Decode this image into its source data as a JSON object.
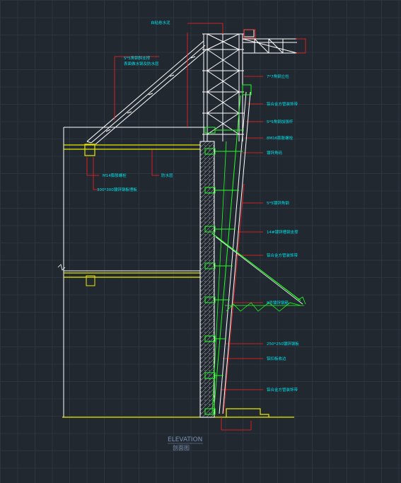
{
  "title": "ELEVATION",
  "subtitle": "剖面图",
  "labels": {
    "top_water": "自粘卷水泥",
    "steel_angle_a": "5*5角钢斜支撑",
    "steel_angle_b": "表面做水钢及防水层",
    "steel_77": "7*7角钢立柱",
    "aluminum_panel_1": "铝合金方管装饰带",
    "steel_55": "5*5角钢加强杆",
    "bolt": "8M16膨胀螺栓",
    "connect_angle": "镀锌角码",
    "bolt_m14": "M14膨胀螺栓",
    "membrane": "防水层",
    "embed_plate": "300*300镀锌钢板埋板",
    "galv_angle": "5*5镀锌角钢",
    "galv_support": "14#镀锌槽钢支撑",
    "aluminum_panel_2": "铝合金方管装饰带",
    "galv_steel_8": "8号镀锌钢筋",
    "galv_plate_250": "250*250镀锌钢板",
    "rain_gutter": "铝扣板收边",
    "aluminum_panel_3": "铝合金方管装饰带"
  },
  "colors": {
    "background": "#212830",
    "structure": "#ffffff",
    "leader": "#ff2020",
    "green": "#20ff20",
    "yellow": "#e8e800",
    "text": "#00e0e8"
  }
}
